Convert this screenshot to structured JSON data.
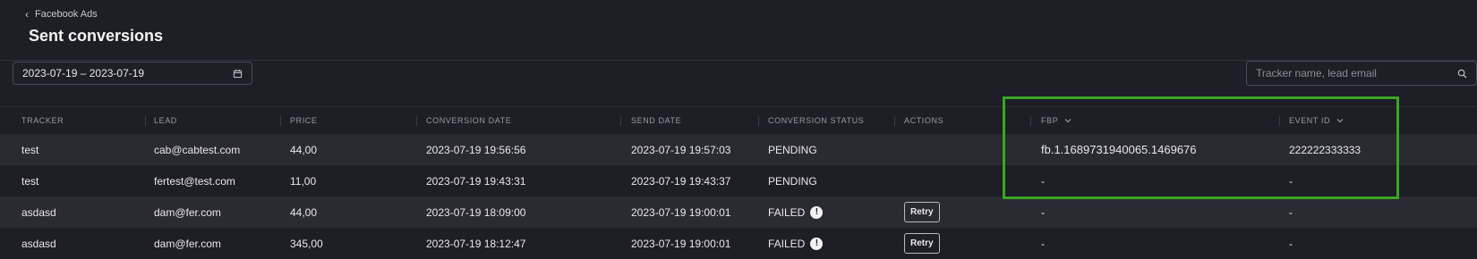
{
  "header": {
    "back_label": "Facebook Ads",
    "title": "Sent conversions"
  },
  "filters": {
    "date_range": "2023-07-19 – 2023-07-19",
    "search_placeholder": "Tracker name, lead email"
  },
  "columns": [
    "TRACKER",
    "LEAD",
    "PRICE",
    "CONVERSION DATE",
    "SEND DATE",
    "CONVERSION STATUS",
    "ACTIONS",
    "FBP",
    "EVENT ID"
  ],
  "rows": [
    {
      "tracker": "test",
      "lead": "cab@cabtest.com",
      "price": "44,00",
      "conversion_date": "2023-07-19 19:56:56",
      "send_date": "2023-07-19 19:57:03",
      "status": "PENDING",
      "action": "",
      "fbp": "fb.1.1689731940065.1469676",
      "event_id": "222222333333"
    },
    {
      "tracker": "test",
      "lead": "fertest@test.com",
      "price": "11,00",
      "conversion_date": "2023-07-19 19:43:31",
      "send_date": "2023-07-19 19:43:37",
      "status": "PENDING",
      "action": "",
      "fbp": "-",
      "event_id": "-"
    },
    {
      "tracker": "asdasd",
      "lead": "dam@fer.com",
      "price": "44,00",
      "conversion_date": "2023-07-19 18:09:00",
      "send_date": "2023-07-19 19:00:01",
      "status": "FAILED",
      "action": "Retry",
      "fbp": "-",
      "event_id": "-"
    },
    {
      "tracker": "asdasd",
      "lead": "dam@fer.com",
      "price": "345,00",
      "conversion_date": "2023-07-19 18:12:47",
      "send_date": "2023-07-19 19:00:01",
      "status": "FAILED",
      "action": "Retry",
      "fbp": "-",
      "event_id": "-"
    }
  ],
  "icons": {
    "back": "chevron-left-icon",
    "calendar": "calendar-icon",
    "search": "search-icon",
    "sort": "chevron-down-icon",
    "status_warning": "exclamation-circle-icon"
  },
  "colors": {
    "background": "#1e1e26",
    "row_alt": "#2a2a33",
    "highlight_box": "#3aa624"
  }
}
